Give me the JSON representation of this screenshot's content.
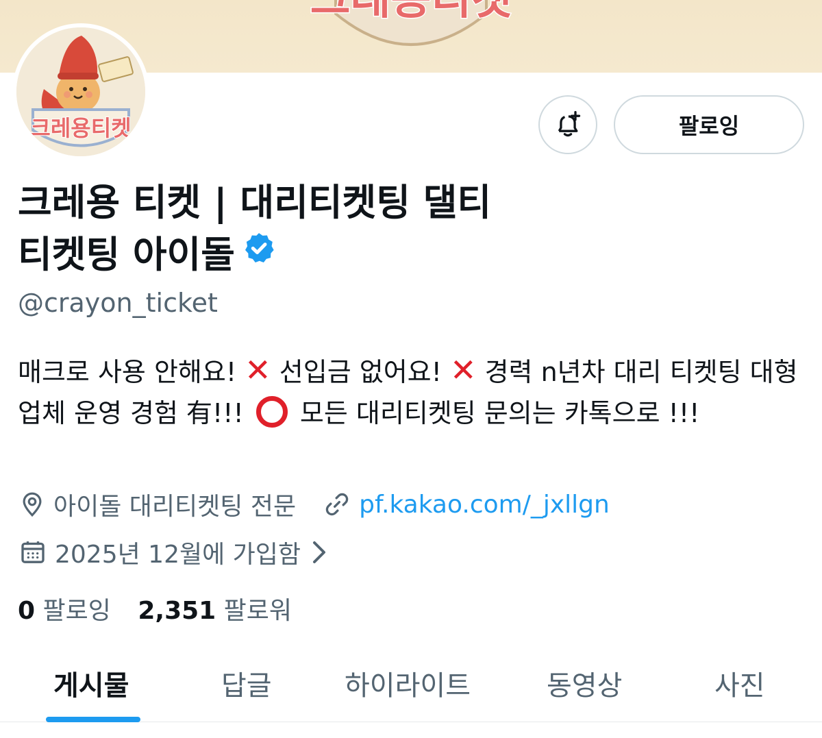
{
  "profile": {
    "display_name_line1": "크레용 티켓 | 대리티켓팅 댈티",
    "display_name_line2": "티켓팅 아이돌",
    "handle": "@crayon_ticket",
    "verified": true,
    "banner_logo_text": "크레용티켓",
    "avatar_logo_text": "크레용티켓"
  },
  "actions": {
    "notify_icon": "bell-plus-icon",
    "follow_label": "팔로잉"
  },
  "bio": {
    "part1": "매크로 사용 안해요! ",
    "part2": " 선입금 없어요! ",
    "part3": " 경력 n년차 대리 티켓팅 대형 업체 운영 경험 有!!! ",
    "part4": " 모든 대리티켓팅 문의는 카톡으로 !!!"
  },
  "meta": {
    "location": "아이돌 대리티켓팅 전문",
    "link": "pf.kakao.com/_jxllgn",
    "joined": "2025년 12월에 가입함"
  },
  "stats": {
    "following_count": "0",
    "following_label": "팔로잉",
    "followers_count": "2,351",
    "followers_label": "팔로워"
  },
  "tabs": [
    {
      "label": "게시물",
      "active": true
    },
    {
      "label": "답글",
      "active": false
    },
    {
      "label": "하이라이트",
      "active": false
    },
    {
      "label": "동영상",
      "active": false
    },
    {
      "label": "사진",
      "active": false
    }
  ],
  "colors": {
    "accent": "#1d9bf0",
    "text_primary": "#0f1419",
    "text_secondary": "#536471",
    "emoji_red": "#e0202a",
    "banner_bg": "#f3e6c9"
  }
}
